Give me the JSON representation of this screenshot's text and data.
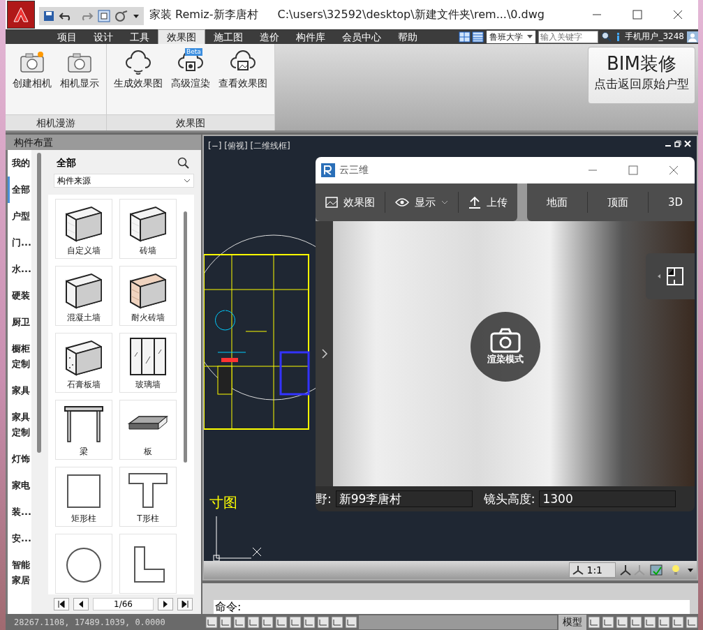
{
  "window": {
    "title": "家装 Remiz-新李唐村",
    "path": "C:\\users\\32592\\desktop\\新建文件夹\\rem...\\0.dwg"
  },
  "menu_tabs": [
    {
      "label": "项目",
      "selected": false
    },
    {
      "label": "设计",
      "selected": false
    },
    {
      "label": "工具",
      "selected": false
    },
    {
      "label": "效果图",
      "selected": true
    },
    {
      "label": "施工图",
      "selected": false
    },
    {
      "label": "造价",
      "selected": false
    },
    {
      "label": "构件库",
      "selected": false
    },
    {
      "label": "会员中心",
      "selected": false
    },
    {
      "label": "帮助",
      "selected": false
    }
  ],
  "menu_right": {
    "portal": "鲁班大学",
    "search_placeholder": "输入关键字",
    "user": "手机用户_3248"
  },
  "ribbon": {
    "groups": [
      {
        "title": "相机漫游",
        "buttons": [
          {
            "label": "创建相机",
            "kind": "camera-new"
          },
          {
            "label": "相机显示",
            "kind": "camera"
          }
        ]
      },
      {
        "title": "效果图",
        "buttons": [
          {
            "label": "生成效果图",
            "kind": "cloud"
          },
          {
            "label": "高级渲染",
            "kind": "cloud-render",
            "badge": "Beta"
          },
          {
            "label": "查看效果图",
            "kind": "cloud-image"
          }
        ]
      }
    ],
    "bim_button": {
      "title": "BIM装修",
      "subtitle": "点击返回原始户型"
    }
  },
  "component_panel": {
    "title": "构件布置",
    "categories": [
      {
        "label": "我的",
        "selected": false
      },
      {
        "label": "全部",
        "selected": true
      },
      {
        "label": "户型",
        "selected": false
      },
      {
        "label": "门...",
        "selected": false
      },
      {
        "label": "水...",
        "selected": false
      },
      {
        "label": "硬装",
        "selected": false
      },
      {
        "label": "厨卫",
        "selected": false
      },
      {
        "label": "橱柜定制",
        "selected": false
      },
      {
        "label": "家具",
        "selected": false
      },
      {
        "label": "家具定制",
        "selected": false
      },
      {
        "label": "灯饰",
        "selected": false
      },
      {
        "label": "家电",
        "selected": false
      },
      {
        "label": "装...",
        "selected": false
      },
      {
        "label": "安...",
        "selected": false
      },
      {
        "label": "智能家居",
        "selected": false
      }
    ],
    "heading": "全部",
    "source_select": "构件来源",
    "items": [
      {
        "label": "自定义墙",
        "kind": "wall"
      },
      {
        "label": "砖墙",
        "kind": "wall"
      },
      {
        "label": "混凝土墙",
        "kind": "concrete"
      },
      {
        "label": "耐火砖墙",
        "kind": "firebrick"
      },
      {
        "label": "石膏板墙",
        "kind": "gypsum"
      },
      {
        "label": "玻璃墙",
        "kind": "glass"
      },
      {
        "label": "梁",
        "kind": "beam"
      },
      {
        "label": "板",
        "kind": "slab"
      },
      {
        "label": "矩形柱",
        "kind": "rect-column"
      },
      {
        "label": "T形柱",
        "kind": "t-column"
      },
      {
        "kind": "round-column"
      },
      {
        "kind": "l-column"
      }
    ],
    "page": "1/66"
  },
  "viewport": {
    "label": "[−] [俯视] [二维线框]",
    "drawing_text": "寸图"
  },
  "dialog": {
    "title": "云三维",
    "toolbar": [
      {
        "label": "效果图",
        "kind": "image"
      },
      {
        "label": "显示",
        "kind": "eye"
      },
      {
        "label": "上传",
        "kind": "upload"
      }
    ],
    "views": [
      "地面",
      "顶面",
      "3D"
    ],
    "overlay_label": "渲染模式",
    "fields": [
      {
        "label": "野:",
        "value": "新99李唐村"
      },
      {
        "label": "镜头高度:",
        "value": "1300"
      }
    ]
  },
  "cad_status": {
    "scale": "1:1"
  },
  "command": {
    "prompt": "命令:"
  },
  "status_bar": {
    "coordinates": "28267.1108, 17489.1039, 0.0000",
    "model": "模型"
  }
}
